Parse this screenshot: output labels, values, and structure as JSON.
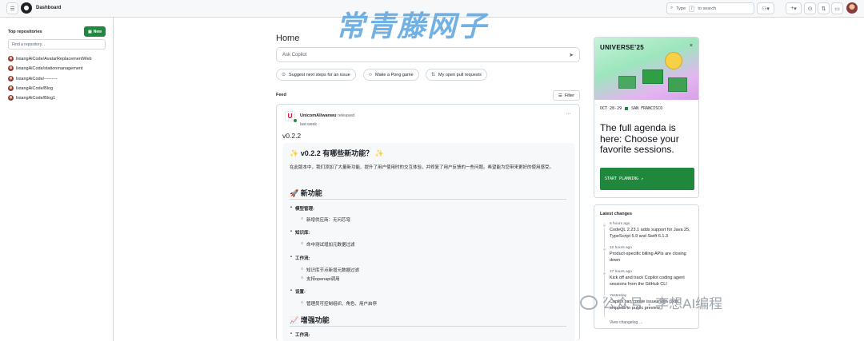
{
  "header": {
    "title": "Dashboard",
    "search_prefix": "Type",
    "search_key": "/",
    "search_suffix": "to search",
    "add_label": "+"
  },
  "sidebar": {
    "title": "Top repositories",
    "new_button": "New",
    "find_placeholder": "Find a repository...",
    "repos": [
      "lixiangAiCode/AvatarReplacementWeb",
      "lixiangAiCode/stationmanagement",
      "lixiangAiCode/---------",
      "lixiangAiCode/Blog",
      "lixiangAiCode/Blog1"
    ]
  },
  "main": {
    "title": "Home",
    "copilot_placeholder": "Ask Copilot",
    "chips": [
      "Suggest next steps for an issue",
      "Make a Pong game",
      "My open pull requests"
    ],
    "feed_label": "Feed",
    "filter_label": "Filter"
  },
  "feed": {
    "actor": "UnicomAI/wanwu",
    "action": "released",
    "time": "last week",
    "version": "v0.2.2",
    "heading": "✨ v0.2.2 有哪些新功能？ ✨",
    "intro": "在此版本中，我们添加了大量新功能、提升了用户使用时的交互体验，并修复了用户反馈的一些问题。希望能为您带来更好的使用感受。",
    "section1": "🚀 新功能",
    "groups": [
      {
        "label": "模型管理:",
        "items": [
          "新增供应商：无问芯穹"
        ]
      },
      {
        "label": "知识库:",
        "items": [
          "命中测试增加元数据过滤"
        ]
      },
      {
        "label": "工作流:",
        "items": [
          "知识库节点新增元数据过滤",
          "支持openapi调用"
        ]
      },
      {
        "label": "设置:",
        "items": [
          "管理员可控制组织、角色、用户启停"
        ]
      }
    ],
    "section2": "📈 增强功能",
    "group_tail": "工作流:"
  },
  "ad": {
    "brand": "UNIVERSE'25",
    "close": "×",
    "date": "OCT 28-29",
    "location": "SAN FRANCISCO",
    "headline": "The full agenda is here: Choose your favorite sessions.",
    "cta": "START PLANNING ↗"
  },
  "changes": {
    "title": "Latest changes",
    "items": [
      {
        "time": "6 hours ago",
        "text": "CodeQL 2.23.1 adds support for Java 25, TypeScript 5.9 and Swift 6.1.3"
      },
      {
        "time": "12 hours ago",
        "text": "Product-specific billing APIs are closing down"
      },
      {
        "time": "17 hours ago",
        "text": "Kick off and track Copilot coding agent sessions from the GitHub CLI"
      },
      {
        "time": "Yesterday",
        "text": "Copilot can create issues with code snippets in public preview"
      }
    ],
    "view": "View changelog →"
  },
  "watermarks": {
    "top": "常青藤网子",
    "bottom": "公众号 · 李想AI编程"
  },
  "colors": {
    "accent_green": "#1f883d",
    "border": "#d1d9e0",
    "muted": "#59636e"
  }
}
